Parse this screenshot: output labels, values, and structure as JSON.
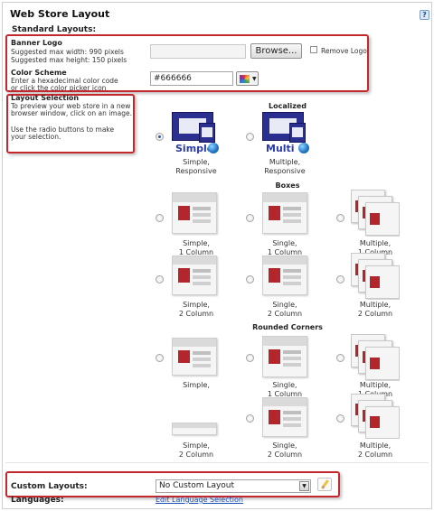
{
  "header": {
    "title": "Web Store Layout",
    "help": "?"
  },
  "standard": {
    "heading": "Standard Layouts:"
  },
  "banner": {
    "label": "Banner Logo",
    "hint1": "Suggested max width: 990 pixels",
    "hint2": "Suggested max height: 150 pixels",
    "browse": "Browse...",
    "remove": "Remove Logo"
  },
  "color": {
    "label": "Color Scheme",
    "hint1": "Enter a hexadecimal color code",
    "hint2": "or click the color picker icon",
    "value": "#666666"
  },
  "layout_selection": {
    "label": "Layout Selection",
    "line1": "To preview your web store in a new",
    "line2": "browser window, click on an image.",
    "line3": "Use the radio buttons to make",
    "line4": "your selection."
  },
  "sections": {
    "localized": "Localized",
    "boxes": "Boxes",
    "rounded": "Rounded Corners"
  },
  "localized": {
    "simple_word": "Simple",
    "multi_word": "Multi",
    "simple_cap1": "Simple,",
    "simple_cap2": "Responsive",
    "multi_cap1": "Multiple,",
    "multi_cap2": "Responsive"
  },
  "boxes": {
    "r1c1a": "Simple,",
    "r1c1b": "1 Column",
    "r1c2a": "Single,",
    "r1c2b": "1 Column",
    "r1c3a": "Multiple,",
    "r1c3b": "1 Column",
    "r2c1a": "Simple,",
    "r2c1b": "2 Column",
    "r2c2a": "Single,",
    "r2c2b": "2 Column",
    "r2c3a": "Multiple,",
    "r2c3b": "2 Column"
  },
  "rounded": {
    "r1c1a": "Simple,",
    "r1c2a": "Single,",
    "r1c2b": "1 Column",
    "r1c3a": "Multiple,",
    "r1c3b": "1 Column",
    "r2c1a": "Simple,",
    "r2c1b": "2 Column",
    "r2c2a": "Single,",
    "r2c2b": "2 Column",
    "r2c3a": "Multiple,",
    "r2c3b": "2 Column"
  },
  "custom": {
    "label": "Custom Layouts:",
    "selected": "No Custom Layout"
  },
  "languages": {
    "label": "Languages:",
    "link": "Edit Language Selection"
  },
  "colors": {
    "highlight": "#c4282e",
    "accent": "#2b2f8f"
  }
}
